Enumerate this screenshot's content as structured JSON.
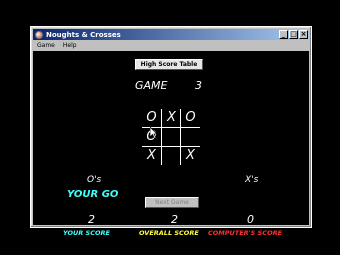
{
  "window": {
    "title": "Noughts & Crosses",
    "controls": {
      "minimize": "_",
      "maximize": "□",
      "close": "×"
    }
  },
  "menu": [
    "Game",
    "Help"
  ],
  "high_score_button": "High Score Table",
  "game": {
    "label": "GAME",
    "number": "3"
  },
  "board": [
    "O",
    "X",
    "O",
    "O",
    "",
    "",
    "X",
    "",
    "X"
  ],
  "next_game_button": "Next Game",
  "players": {
    "noughts": "O's",
    "crosses": "X's",
    "turn": "YOUR GO"
  },
  "scores": {
    "your": {
      "value": "2",
      "label": "YOUR SCORE",
      "color": "#40ffff"
    },
    "overall": {
      "value": "2",
      "label": "OVERALL SCORE",
      "color": "#ffff40"
    },
    "computer": {
      "value": "0",
      "label": "COMPUTER'S SCORE",
      "color": "#ff3030"
    }
  }
}
